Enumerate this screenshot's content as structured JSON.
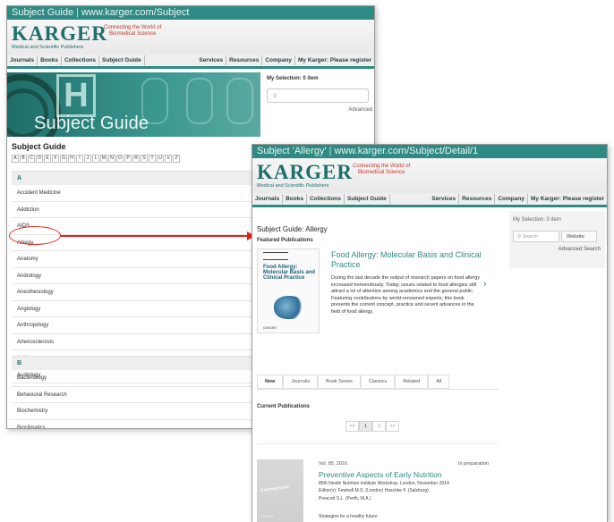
{
  "window1": {
    "title": "Subject Guide",
    "url": "www.karger.com/Subject",
    "logo": "KARGER",
    "logo_sub": "Medical and Scientific Publishers",
    "tagline1": "Connecting the World of",
    "tagline2": "Biomedical Science",
    "nav_left": [
      "Journals",
      "Books",
      "Collections",
      "Subject Guide"
    ],
    "nav_right": [
      "Services",
      "Resources",
      "Company",
      "My Karger: Please register"
    ],
    "hero_title": "Subject Guide",
    "my_selection": "My Selection: 0 item",
    "search_placeholder": "",
    "advanced": "Advanced",
    "subject_guide_title": "Subject Guide",
    "alphabet": [
      "A",
      "B",
      "C",
      "D",
      "E",
      "F",
      "G",
      "H",
      "I",
      "J",
      "L",
      "M",
      "N",
      "O",
      "P",
      "R",
      "S",
      "T",
      "U",
      "V",
      "Z"
    ],
    "section_a": "A",
    "items_a": [
      "Accident Medicine",
      "Addiction",
      "AIDS",
      "Allergy",
      "Anatomy",
      "Andrology",
      "Anesthesiology",
      "Angiology",
      "Anthropology",
      "Arteriosclerosis",
      "Asthma",
      "Audiology"
    ],
    "section_b": "B",
    "items_b": [
      "Bacteriology",
      "Behavioral Research",
      "Biochemistry",
      "Bioclimatics"
    ]
  },
  "window2": {
    "title": "Subject 'Allergy'",
    "url": "www.karger.com/Subject/Detail/1",
    "logo": "KARGER",
    "logo_sub": "Medical and Scientific Publishers",
    "tagline1": "Connecting the World of",
    "tagline2": "Biomedical Science",
    "nav_left": [
      "Journals",
      "Books",
      "Collections",
      "Subject Guide"
    ],
    "nav_right": [
      "Services",
      "Resources",
      "Company",
      "My Karger: Please register"
    ],
    "my_selection": "My Selection: 0 item",
    "search_placeholder": "Search",
    "website_btn": "Website",
    "advanced_search": "Advanced Search",
    "heading": "Subject Guide: Allergy",
    "featured_label": "Featured Publications",
    "book_cover_title": "Food Allergy: Molecular Basis and Clinical Practice",
    "book_cover_publisher": "KARGER",
    "featured_title": "Food Allergy: Molecular Basis and Clinical Practice",
    "featured_desc": "During the last decade the output of research papers on food allergy increased tremendously. Today, issues related to food allergies still attract a lot of attention among academics and the general public. Featuring contributions by world-renowned experts, this book presents the current concept, practice and recent advances in the field of food allergy.",
    "tabs": [
      "New",
      "Journals",
      "Book Series",
      "Classics",
      "Related",
      "All"
    ],
    "current_pubs": "Current Publications",
    "pager": [
      "<<",
      "1",
      "2",
      ">>"
    ],
    "pub_cover_text": "Coming soon",
    "pub_cover_publisher": "KARGER",
    "pub_vol": "Vol. 85, 2016",
    "pub_status": "In preparation",
    "pub_title": "Preventive Aspects of Early Nutrition",
    "pub_line1": "85th Nestlé Nutrition Institute Workshop, London, November 2014",
    "pub_line2": "Editor(s): Fewtrell M.S. (London)  Haschke F. (Salzburg)",
    "pub_line3": "Prescott S.L. (Perth, W.A.)",
    "pub_line4": "Strategies for a healthy future"
  }
}
